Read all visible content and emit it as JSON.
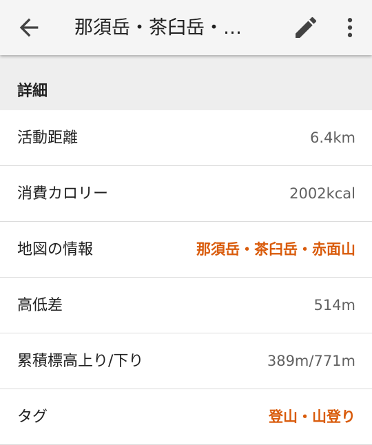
{
  "appbar": {
    "title": "那須岳・茶臼岳・…",
    "back_icon": "arrow-left-icon",
    "edit_icon": "pencil-icon",
    "more_icon": "more-vertical-icon"
  },
  "section": {
    "title": "詳細"
  },
  "details": [
    {
      "label": "活動距離",
      "value": "6.4km",
      "is_link": false
    },
    {
      "label": "消費カロリー",
      "value": "2002kcal",
      "is_link": false
    },
    {
      "label": "地図の情報",
      "value": "那須岳・茶臼岳・赤面山",
      "is_link": true
    },
    {
      "label": "高低差",
      "value": "514m",
      "is_link": false
    },
    {
      "label": "累積標高上り/下り",
      "value": "389m/771m",
      "is_link": false
    },
    {
      "label": "タグ",
      "value": "登山・山登り",
      "is_link": true
    }
  ],
  "colors": {
    "accent": "#d95b0b",
    "appbar_bg": "#f5f5f5",
    "section_bg": "#eeeeee",
    "text_primary": "#212121",
    "text_secondary": "#616161"
  }
}
